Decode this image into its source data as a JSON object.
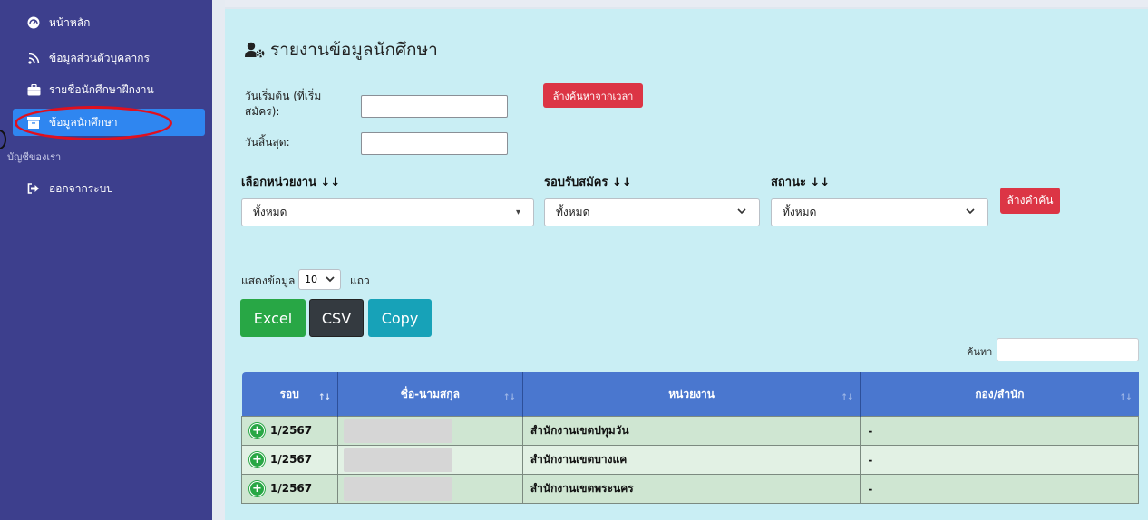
{
  "sidebar": {
    "items": [
      {
        "label": "หน้าหลัก",
        "icon": "dashboard-icon"
      },
      {
        "label": "ข้อมูลส่วนตัวบุคลากร",
        "icon": "rss-icon"
      },
      {
        "label": "รายชื่อนักศึกษาฝึกงาน",
        "icon": "briefcase-icon"
      },
      {
        "label": "ข้อมูลนักศึกษา",
        "icon": "archive-icon",
        "active": true
      }
    ],
    "section_label": "บัญชีของเรา",
    "logout_label": "ออกจากระบบ"
  },
  "page": {
    "title": "รายงานข้อมูลนักศึกษา"
  },
  "date_filter": {
    "start_label_line1": "วันเริ่มต้น (ที่เริ่ม",
    "start_label_line2": "สมัคร):",
    "start_value": "",
    "end_label": "วันสิ้นสุด:",
    "end_value": "",
    "clear_time_button": "ล้างค้นหาจากเวลา"
  },
  "filters": {
    "unit": {
      "label": "เลือกหน่วยงาน ↓↓",
      "value": "ทั้งหมด"
    },
    "round": {
      "label": "รอบรับสมัคร ↓↓",
      "value": "ทั้งหมด"
    },
    "status": {
      "label": "สถานะ ↓↓",
      "value": "ทั้งหมด"
    },
    "clear_button": "ล้างคำค้น"
  },
  "table_controls": {
    "show_label": "แสดงข้อมูล",
    "page_length": "10",
    "rows_label": "แถว",
    "excel": "Excel",
    "csv": "CSV",
    "copy": "Copy",
    "search_label": "ค้นหา",
    "search_value": ""
  },
  "table": {
    "columns": [
      "รอบ",
      "ชื่อ-นามสกุล",
      "หน่วยงาน",
      "กอง/สำนัก"
    ],
    "rows": [
      {
        "round": "1/2567",
        "name": "",
        "unit": "สำนักงานเขตปทุมวัน",
        "division": "-"
      },
      {
        "round": "1/2567",
        "name": "",
        "unit": "สำนักงานเขตบางแค",
        "division": "-"
      },
      {
        "round": "1/2567",
        "name": "",
        "unit": "สำนักงานเขตพระนคร",
        "division": "-"
      }
    ]
  },
  "colors": {
    "sidebar_bg": "#3d3f8d",
    "active_item": "#2f86f0",
    "main_bg": "#c9eef4",
    "danger": "#dc3545",
    "excel": "#28a745",
    "csv": "#343a40",
    "copy": "#17a2b8",
    "table_header": "#4a77cf",
    "annotation": "#e0101e"
  }
}
